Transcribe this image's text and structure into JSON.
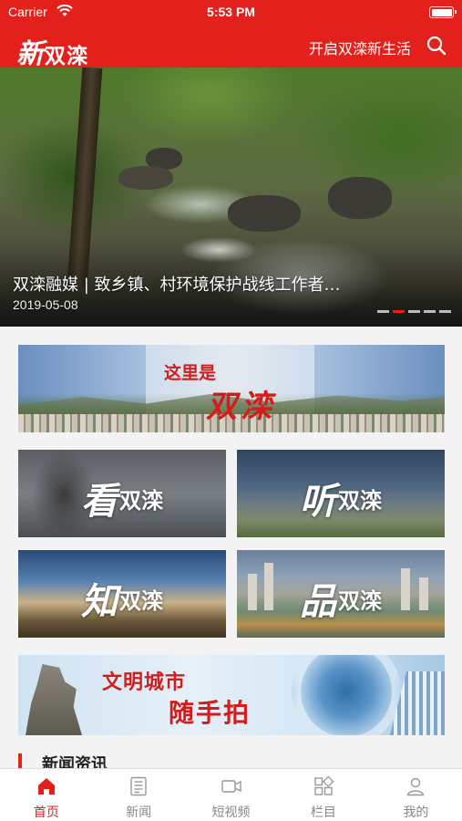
{
  "status_bar": {
    "carrier": "Carrier",
    "time": "5:53 PM",
    "battery_level": 1.0
  },
  "navbar": {
    "logo_first": "新",
    "logo_rest": "双滦",
    "slogan": "开启双滦新生活",
    "search_icon": "search-icon",
    "color": "#e4201c"
  },
  "banner": {
    "headline": "双滦融媒 | 致乡镇、村环境保护战线工作者…",
    "date": "2019-05-08",
    "slide_count": 5,
    "active_slide": 2
  },
  "promo_top": {
    "line1": "这里是",
    "line2": "双滦"
  },
  "tiles": [
    {
      "big": "看",
      "small": "双滦"
    },
    {
      "big": "听",
      "small": "双滦"
    },
    {
      "big": "知",
      "small": "双滦"
    },
    {
      "big": "品",
      "small": "双滦"
    }
  ],
  "promo_bottom": {
    "line1": "文明城市",
    "line2": "随手拍"
  },
  "section": {
    "title": "新闻资讯"
  },
  "tabbar": {
    "active_color": "#e4201c",
    "items": [
      {
        "label": "首页",
        "icon": "home-icon",
        "active": true
      },
      {
        "label": "新闻",
        "icon": "news-icon",
        "active": false
      },
      {
        "label": "短视频",
        "icon": "video-icon",
        "active": false
      },
      {
        "label": "栏目",
        "icon": "columns-icon",
        "active": false
      },
      {
        "label": "我的",
        "icon": "profile-icon",
        "active": false
      }
    ]
  }
}
